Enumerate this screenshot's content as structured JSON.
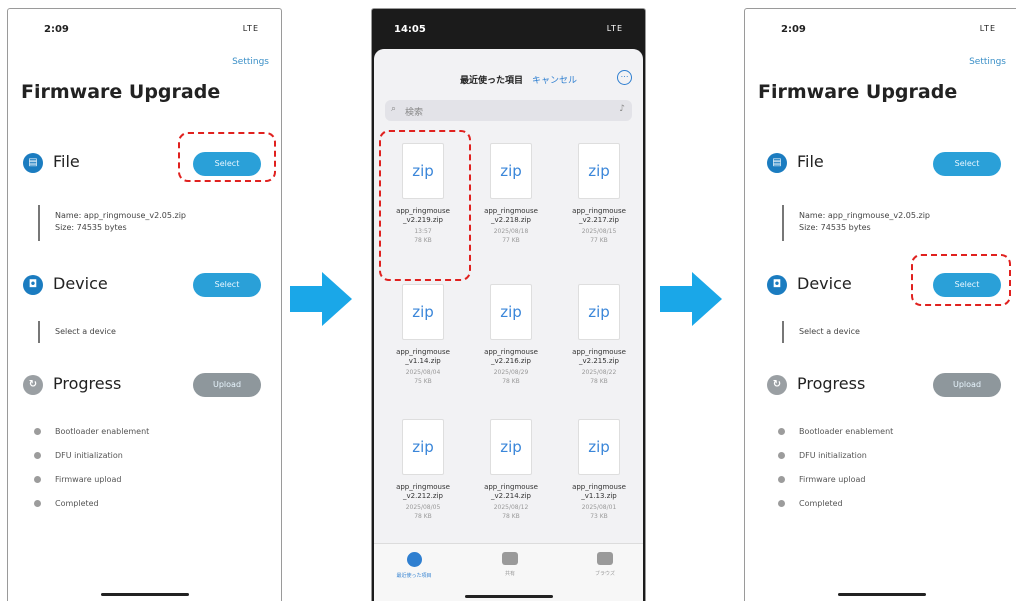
{
  "left": {
    "status_time": "2:09",
    "status_icons": "LTE",
    "settings": "Settings",
    "title": "Firmware Upgrade",
    "file_title": "File",
    "file_button": "Select",
    "file_name": "Name: app_ringmouse_v2.05.zip",
    "file_size": "Size: 74535 bytes",
    "device_title": "Device",
    "device_button": "Select",
    "device_info": "Select a device",
    "progress_title": "Progress",
    "progress_button": "Upload",
    "steps": [
      "Bootloader enablement",
      "DFU initialization",
      "Firmware upload",
      "Completed"
    ]
  },
  "picker": {
    "status_time": "14:05",
    "status_icons": "LTE",
    "title": "最近使った項目",
    "cancel": "キャンセル",
    "more": "⋯",
    "search_placeholder": "検索",
    "zip_label": "zip",
    "files": [
      {
        "name": "app_ringmouse\n_v2.219.zip",
        "meta": "13:57\n78 KB"
      },
      {
        "name": "app_ringmouse\n_v2.218.zip",
        "meta": "2025/08/18\n77 KB"
      },
      {
        "name": "app_ringmouse\n_v2.217.zip",
        "meta": "2025/08/15\n77 KB"
      },
      {
        "name": "app_ringmouse\n_v1.14.zip",
        "meta": "2025/08/04\n75 KB"
      },
      {
        "name": "app_ringmouse\n_v2.216.zip",
        "meta": "2025/08/29\n78 KB"
      },
      {
        "name": "app_ringmouse\n_v2.215.zip",
        "meta": "2025/08/22\n78 KB"
      },
      {
        "name": "app_ringmouse\n_v2.212.zip",
        "meta": "2025/08/05\n78 KB"
      },
      {
        "name": "app_ringmouse\n_v2.214.zip",
        "meta": "2025/08/12\n78 KB"
      },
      {
        "name": "app_ringmouse\n_v1.13.zip",
        "meta": "2025/08/01\n73 KB"
      }
    ],
    "tabs": [
      "最近使った項目",
      "共有",
      "ブラウズ"
    ]
  },
  "right": {
    "status_time": "2:09",
    "status_icons": "LTE",
    "settings": "Settings",
    "title": "Firmware Upgrade",
    "file_title": "File",
    "file_button": "Select",
    "file_name": "Name: app_ringmouse_v2.05.zip",
    "file_size": "Size: 74535 bytes",
    "device_title": "Device",
    "device_button": "Select",
    "device_info": "Select a device",
    "progress_title": "Progress",
    "progress_button": "Upload",
    "steps": [
      "Bootloader enablement",
      "DFU initialization",
      "Firmware upload",
      "Completed"
    ]
  },
  "colors": {
    "accent": "#2aa0d8",
    "highlight": "#e0211f",
    "arrow": "#1aa7e8"
  }
}
